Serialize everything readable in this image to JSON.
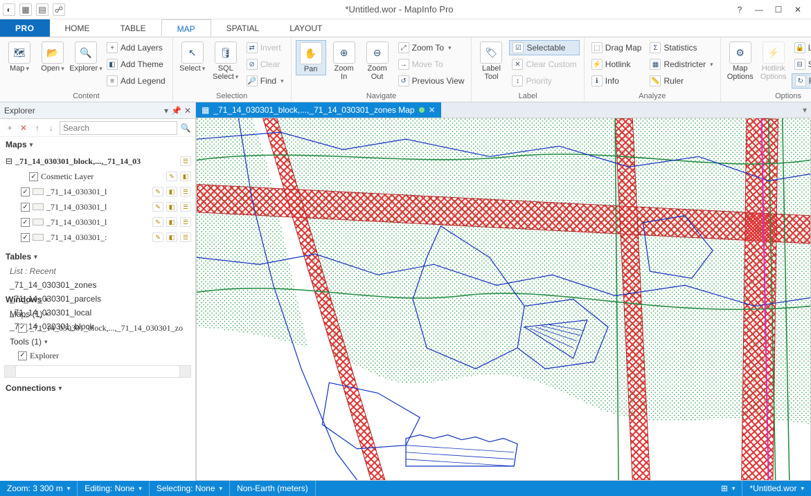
{
  "app": {
    "title": "*Untitled.wor - MapInfo Pro"
  },
  "tabs": {
    "pro": "PRO",
    "home": "HOME",
    "table": "TABLE",
    "map": "MAP",
    "spatial": "SPATIAL",
    "layout": "LAYOUT"
  },
  "ribbon": {
    "content": {
      "label": "Content",
      "map": "Map",
      "open": "Open",
      "explorer": "Explorer",
      "add_layers": "Add Layers",
      "add_theme": "Add Theme",
      "add_legend": "Add Legend"
    },
    "selection": {
      "label": "Selection",
      "select": "Select",
      "sql": "SQL\nSelect",
      "invert": "Invert",
      "clear": "Clear",
      "find": "Find"
    },
    "navigate": {
      "label": "Navigate",
      "pan": "Pan",
      "zoom_in": "Zoom\nIn",
      "zoom_out": "Zoom\nOut",
      "zoom_to": "Zoom To",
      "move_to": "Move To",
      "previous_view": "Previous View"
    },
    "label": {
      "label": "Label",
      "label_tool": "Label\nTool",
      "selectable": "Selectable",
      "clear_custom": "Clear Custom",
      "priority": "Priority"
    },
    "analyze": {
      "label": "Analyze",
      "drag_map": "Drag Map",
      "hotlink": "Hotlink",
      "info": "Info",
      "statistics": "Statistics",
      "redistricter": "Redistricter",
      "ruler": "Ruler"
    },
    "options": {
      "label": "Options",
      "map_options": "Map\nOptions",
      "hotlink_options": "Hotlink\nOptions",
      "lock_scale": "Lock Scale",
      "scalebar": "Scalebar",
      "redraw": "Redraw"
    }
  },
  "explorer": {
    "title": "Explorer",
    "search_placeholder": "Search",
    "maps_section": "Maps",
    "root_item": "_71_14_030301_block,...,_71_14_03",
    "layers": [
      {
        "name": "Cosmetic Layer",
        "checked": true,
        "shade": true
      },
      {
        "name": "_71_14_030301_l",
        "checked": true
      },
      {
        "name": "_71_14_030301_l",
        "checked": true
      },
      {
        "name": "_71_14_030301_l",
        "checked": true
      },
      {
        "name": "_71_14_030301_:",
        "checked": true
      }
    ],
    "tables_section": "Tables",
    "tables_sub": "List : Recent",
    "tables": [
      "_71_14_030301_zones",
      "_71_14_030301_parcels",
      "_71_14_030301_local",
      "_71_14_030301_block"
    ],
    "windows_section": "Windows",
    "windows_maps": "Maps (1)",
    "windows_map_item": "_71_14_030301_block,...,_71_14_030301_zo",
    "tools_section": "Tools (1)",
    "tools_item": "Explorer",
    "connections_section": "Connections"
  },
  "map_tab": {
    "title": "_71_14_030301_block,...,_71_14_030301_zones Map"
  },
  "status": {
    "zoom": "Zoom: 3 300 m",
    "editing": "Editing: None",
    "selecting": "Selecting: None",
    "proj": "Non-Earth (meters)",
    "file": "*Untitled.wor"
  }
}
